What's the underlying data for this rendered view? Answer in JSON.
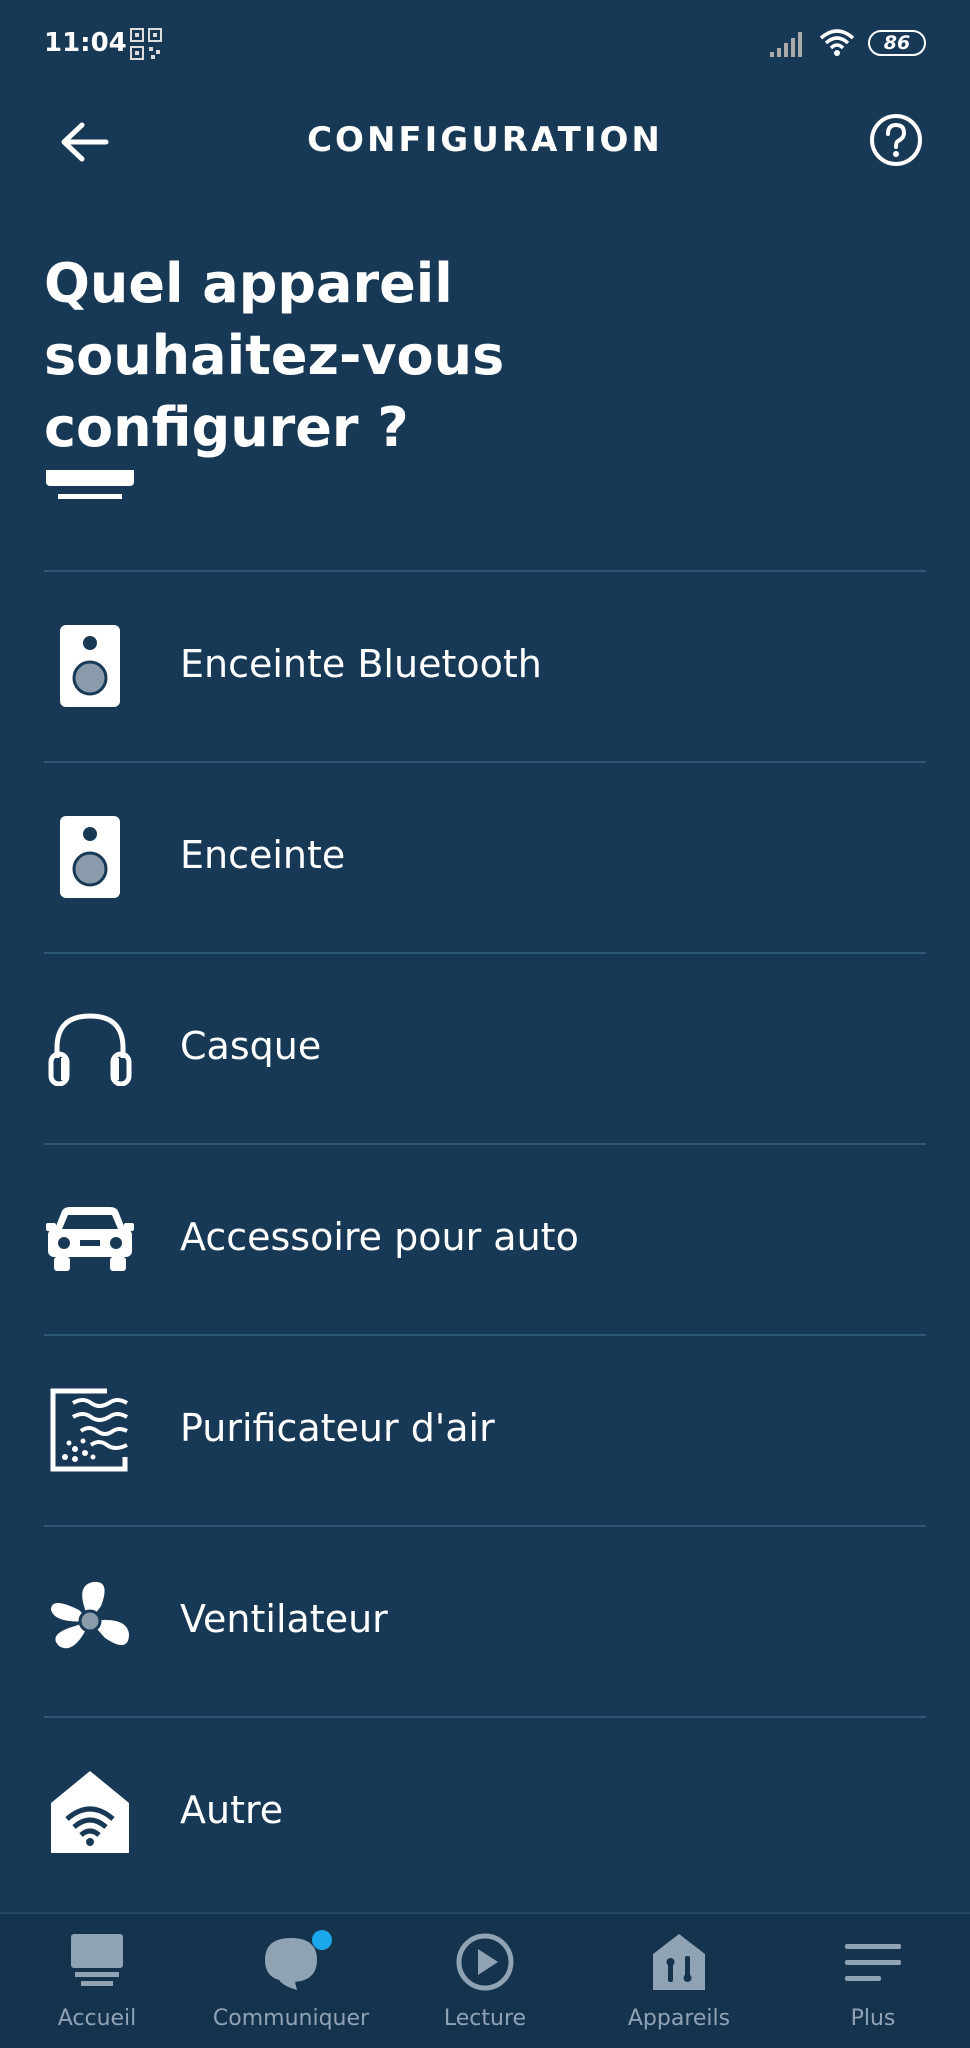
{
  "status_bar": {
    "time": "11:04",
    "battery": "86"
  },
  "header": {
    "title": "CONFIGURATION"
  },
  "page_title": "Quel appareil souhaitez-vous configurer ?",
  "devices": [
    {
      "label": "Enceinte Bluetooth",
      "icon": "speaker-icon"
    },
    {
      "label": "Enceinte",
      "icon": "speaker-icon"
    },
    {
      "label": "Casque",
      "icon": "headphones-icon"
    },
    {
      "label": "Accessoire pour auto",
      "icon": "car-icon"
    },
    {
      "label": "Purificateur d'air",
      "icon": "air-purifier-icon"
    },
    {
      "label": "Ventilateur",
      "icon": "fan-icon"
    },
    {
      "label": "Autre",
      "icon": "wifi-home-icon"
    }
  ],
  "bottom_nav": [
    {
      "label": "Accueil",
      "icon": "home-icon"
    },
    {
      "label": "Communiquer",
      "icon": "chat-icon"
    },
    {
      "label": "Lecture",
      "icon": "play-icon"
    },
    {
      "label": "Appareils",
      "icon": "devices-icon"
    },
    {
      "label": "Plus",
      "icon": "menu-icon"
    }
  ],
  "colors": {
    "background": "#183955",
    "divider": "#2e5677",
    "nav_label": "#8fa3b5",
    "badge": "#1aa7ec"
  }
}
